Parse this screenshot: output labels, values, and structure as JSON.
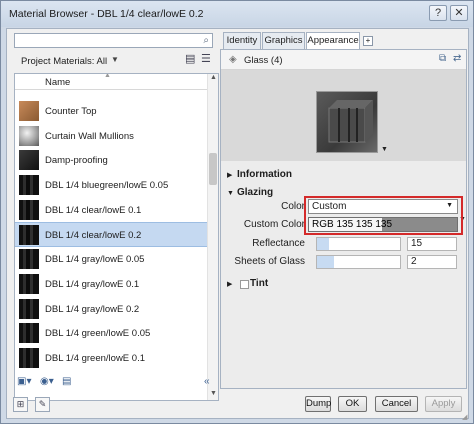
{
  "window": {
    "title": "Material Browser - DBL 1/4 clear/lowE 0.2",
    "help_label": "?",
    "close_label": "✕"
  },
  "search": {
    "value": "",
    "icon": "search-icon"
  },
  "filter": {
    "label": "Project Materials: All"
  },
  "list": {
    "column_header": "Name",
    "selected_index": 7,
    "items": [
      {
        "label": "Counter Top",
        "thumb": "wood"
      },
      {
        "label": "Curtain Wall Mullions",
        "thumb": "metal"
      },
      {
        "label": "Damp-proofing",
        "thumb": "dark"
      },
      {
        "label": "DBL 1/4 bluegreen/lowE 0.05",
        "thumb": "glass"
      },
      {
        "label": "DBL 1/4 clear/lowE 0.1",
        "thumb": "glass"
      },
      {
        "label": "DBL 1/4 clear/lowE 0.2",
        "thumb": "glass"
      },
      {
        "label": "DBL 1/4 gray/lowE 0.05",
        "thumb": "glass"
      },
      {
        "label": "DBL 1/4 gray/lowE 0.1",
        "thumb": "glass"
      },
      {
        "label": "DBL 1/4 gray/lowE 0.2",
        "thumb": "glass"
      },
      {
        "label": "DBL 1/4 green/lowE 0.05",
        "thumb": "glass"
      },
      {
        "label": "DBL 1/4 green/lowE 0.1",
        "thumb": "glass"
      }
    ]
  },
  "tabs": [
    {
      "label": "Identity",
      "active": false
    },
    {
      "label": "Graphics",
      "active": false
    },
    {
      "label": "Appearance",
      "active": true
    }
  ],
  "tab_add_label": "+",
  "asset": {
    "name": "Glass (4)"
  },
  "sections": {
    "information": "Information",
    "glazing": "Glazing",
    "tint": "Tint"
  },
  "properties": {
    "color_label": "Color",
    "color_value": "Custom",
    "custom_color_label": "Custom Color",
    "custom_color_value": "RGB 135 135 135",
    "reflectance_label": "Reflectance",
    "reflectance_value": "15",
    "reflectance_fraction": 0.15,
    "sheets_label": "Sheets of Glass",
    "sheets_value": "2",
    "sheets_fraction": 0.2
  },
  "buttons": {
    "dump": "Dump",
    "ok": "OK",
    "cancel": "Cancel",
    "apply": "Apply"
  },
  "colors": {
    "highlight": "#d42a2a",
    "selection": "#c5d9f1",
    "custom_color": "#878787"
  }
}
